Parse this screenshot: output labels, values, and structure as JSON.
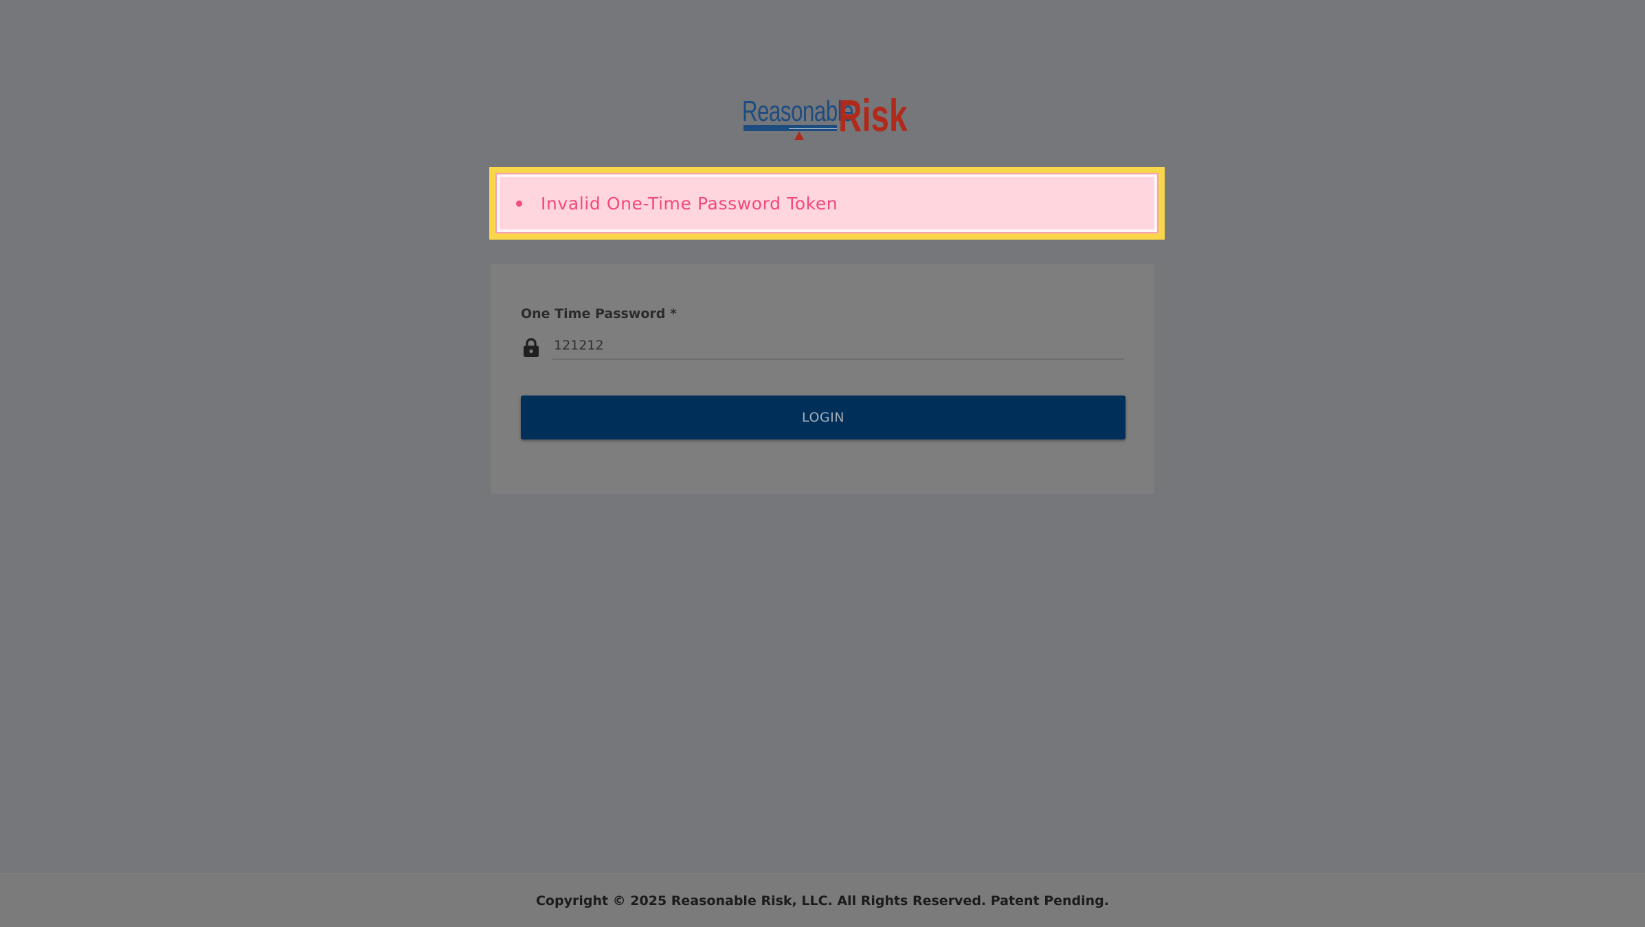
{
  "logo": {
    "word_primary": "Reasonable",
    "word_secondary": "Risk",
    "primary_color": "#1c4c80",
    "secondary_color": "#b02a1c"
  },
  "alert": {
    "message": "Invalid One-Time Password Token",
    "text_color": "#f24978",
    "background_color": "#ffd6de",
    "highlight_color": "#f9d64a"
  },
  "form": {
    "otp_label": "One Time Password *",
    "otp_value": "121212",
    "lock_icon": "lock-icon",
    "login_label": "LOGIN",
    "button_color": "#00305a"
  },
  "footer": {
    "copyright": "Copyright © 2025 Reasonable Risk, LLC. All Rights Reserved. Patent Pending."
  }
}
